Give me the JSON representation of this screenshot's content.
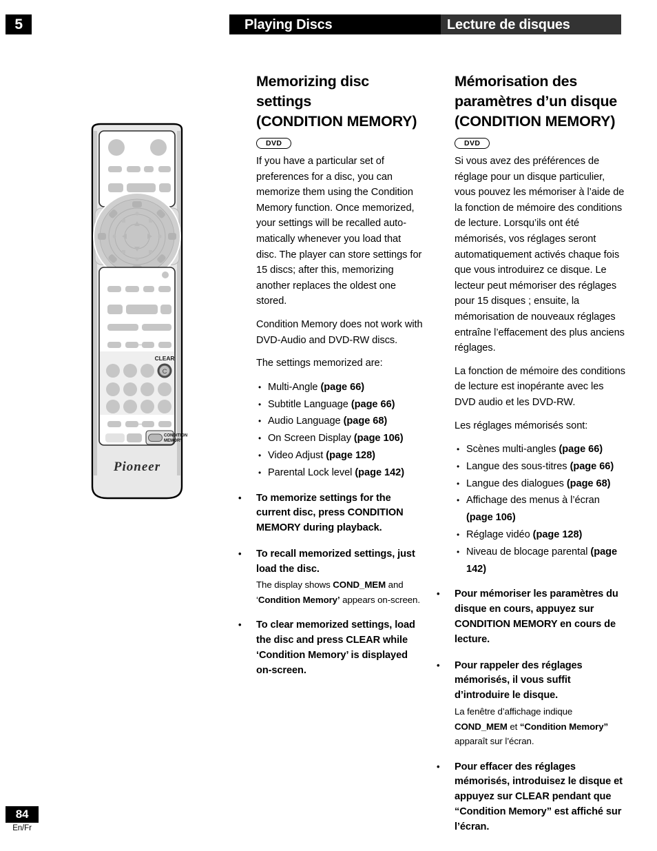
{
  "header": {
    "chapter_number": "5",
    "title_en": "Playing Discs",
    "title_fr": "Lecture de disques",
    "bg_en": "#000000",
    "bg_fr": "#333333"
  },
  "footer": {
    "page_number": "84",
    "language_code": "En/Fr"
  },
  "figure": {
    "name": "remote-control",
    "brand": "Pioneer",
    "labels": {
      "clear": "CLEAR",
      "clear_glyph": "C",
      "condition_line1": "CONDITION",
      "condition_line2": "MEMORY"
    }
  },
  "english": {
    "title_line1": "Memorizing disc settings",
    "title_line2": "(CONDITION MEMORY)",
    "badge": "DVD",
    "para1": "If you have a particular set of preferences for a disc, you can memorize them using the Condition Memory function. Once memorized, your settings will be recalled auto-matically whenever you load that disc. The player can store settings for 15 discs; after this, memorizing another replaces the oldest one stored.",
    "para2": "Condition Memory does not work with DVD-Audio and DVD-RW discs.",
    "para3": "The settings memorized are:",
    "settings": [
      {
        "label": "Multi-Angle ",
        "page": "(page 66)"
      },
      {
        "label": "Subtitle Language ",
        "page": "(page 66)"
      },
      {
        "label": "Audio Language ",
        "page": "(page 68)"
      },
      {
        "label": "On Screen Display ",
        "page": "(page 106)"
      },
      {
        "label": "Video Adjust ",
        "page": "(page 128)"
      },
      {
        "label": "Parental Lock level ",
        "page": "(page 142)"
      }
    ],
    "instructions": [
      {
        "bold": "To memorize settings for the current disc, press CONDITION MEMORY during playback.",
        "note_pre": "",
        "note_b1": "",
        "note_mid": "",
        "note_b2": "",
        "note_post": ""
      },
      {
        "bold": "To recall memorized settings, just load the disc.",
        "note_pre": "The display shows ",
        "note_b1": "COND_MEM",
        "note_mid": " and ‘",
        "note_b2": "Condition Memory’",
        "note_post": " appears on-screen."
      },
      {
        "bold": "To clear memorized settings, load the disc and press CLEAR while ‘Condition Memory’ is displayed on-screen.",
        "note_pre": "",
        "note_b1": "",
        "note_mid": "",
        "note_b2": "",
        "note_post": ""
      }
    ]
  },
  "french": {
    "title_line1": "Mémorisation des",
    "title_line2": "paramètres d’un disque",
    "title_line3": "(CONDITION MEMORY)",
    "badge": "DVD",
    "para1": "Si vous avez des préférences de réglage pour un disque particulier, vous pouvez les mémoriser à l’aide de la fonction de mémoire des conditions de lecture. Lorsqu’ils ont été mémorisés, vos réglages seront automatiquement activés chaque fois que vous introduirez ce disque. Le lecteur peut mémoriser des réglages pour 15 disques ; ensuite, la mémorisation de nouveaux réglages entraîne l’effacement des plus anciens réglages.",
    "para2": "La fonction de mémoire des conditions de lecture est inopérante avec les DVD audio et les DVD-RW.",
    "para3": "Les réglages mémorisés sont:",
    "settings": [
      {
        "label": "Scènes multi-angles ",
        "page": "(page 66)"
      },
      {
        "label": "Langue des sous-titres ",
        "page": "(page 66)"
      },
      {
        "label": "Langue des dialogues ",
        "page": "(page 68)"
      },
      {
        "label": "Affichage des menus à l’écran ",
        "page": "(page 106)"
      },
      {
        "label": "Réglage vidéo ",
        "page": "(page 128)"
      },
      {
        "label": "Niveau de blocage parental ",
        "page": "(page 142)"
      }
    ],
    "instructions": [
      {
        "bold": "Pour mémoriser les paramètres du disque en cours, appuyez sur CONDITION MEMORY en cours de lecture.",
        "note_pre": "",
        "note_b1": "",
        "note_mid": "",
        "note_b2": "",
        "note_post": ""
      },
      {
        "bold": "Pour rappeler des réglages mémorisés, il vous suffit d’introduire le disque.",
        "note_pre": "La fenêtre d’affichage indique ",
        "note_b1": "COND_MEM",
        "note_mid": " et ",
        "note_b2": "“Condition Memory”",
        "note_post": " apparaît sur l’écran."
      },
      {
        "bold": "Pour effacer des réglages mémorisés, introduisez le disque et appuyez sur CLEAR pendant que “Condition Memory” est affiché sur l’écran.",
        "note_pre": "",
        "note_b1": "",
        "note_mid": "",
        "note_b2": "",
        "note_post": ""
      }
    ]
  }
}
